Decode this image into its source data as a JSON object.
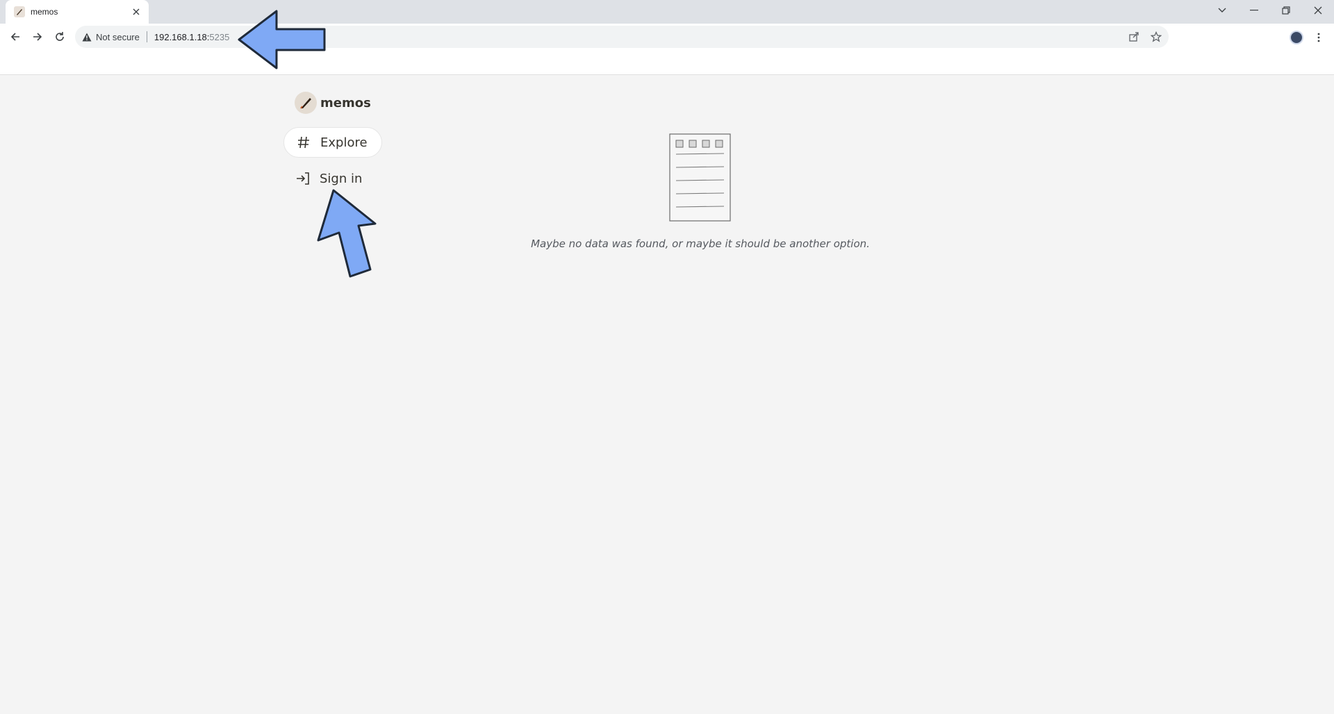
{
  "browser": {
    "tab_title": "memos",
    "security_label": "Not secure",
    "url_host": "192.168.1.18:",
    "url_port": "5235"
  },
  "sidebar": {
    "brand_name": "memos",
    "items": [
      {
        "label": "Explore",
        "icon": "hash-icon",
        "active": true
      },
      {
        "label": "Sign in",
        "icon": "sign-in-icon",
        "active": false
      }
    ]
  },
  "main": {
    "empty_message": "Maybe no data was found, or maybe it should be another option."
  },
  "colors": {
    "arrow_fill": "#7fa9f5",
    "arrow_stroke": "#1f2a3a",
    "page_bg": "#f4f4f4"
  }
}
